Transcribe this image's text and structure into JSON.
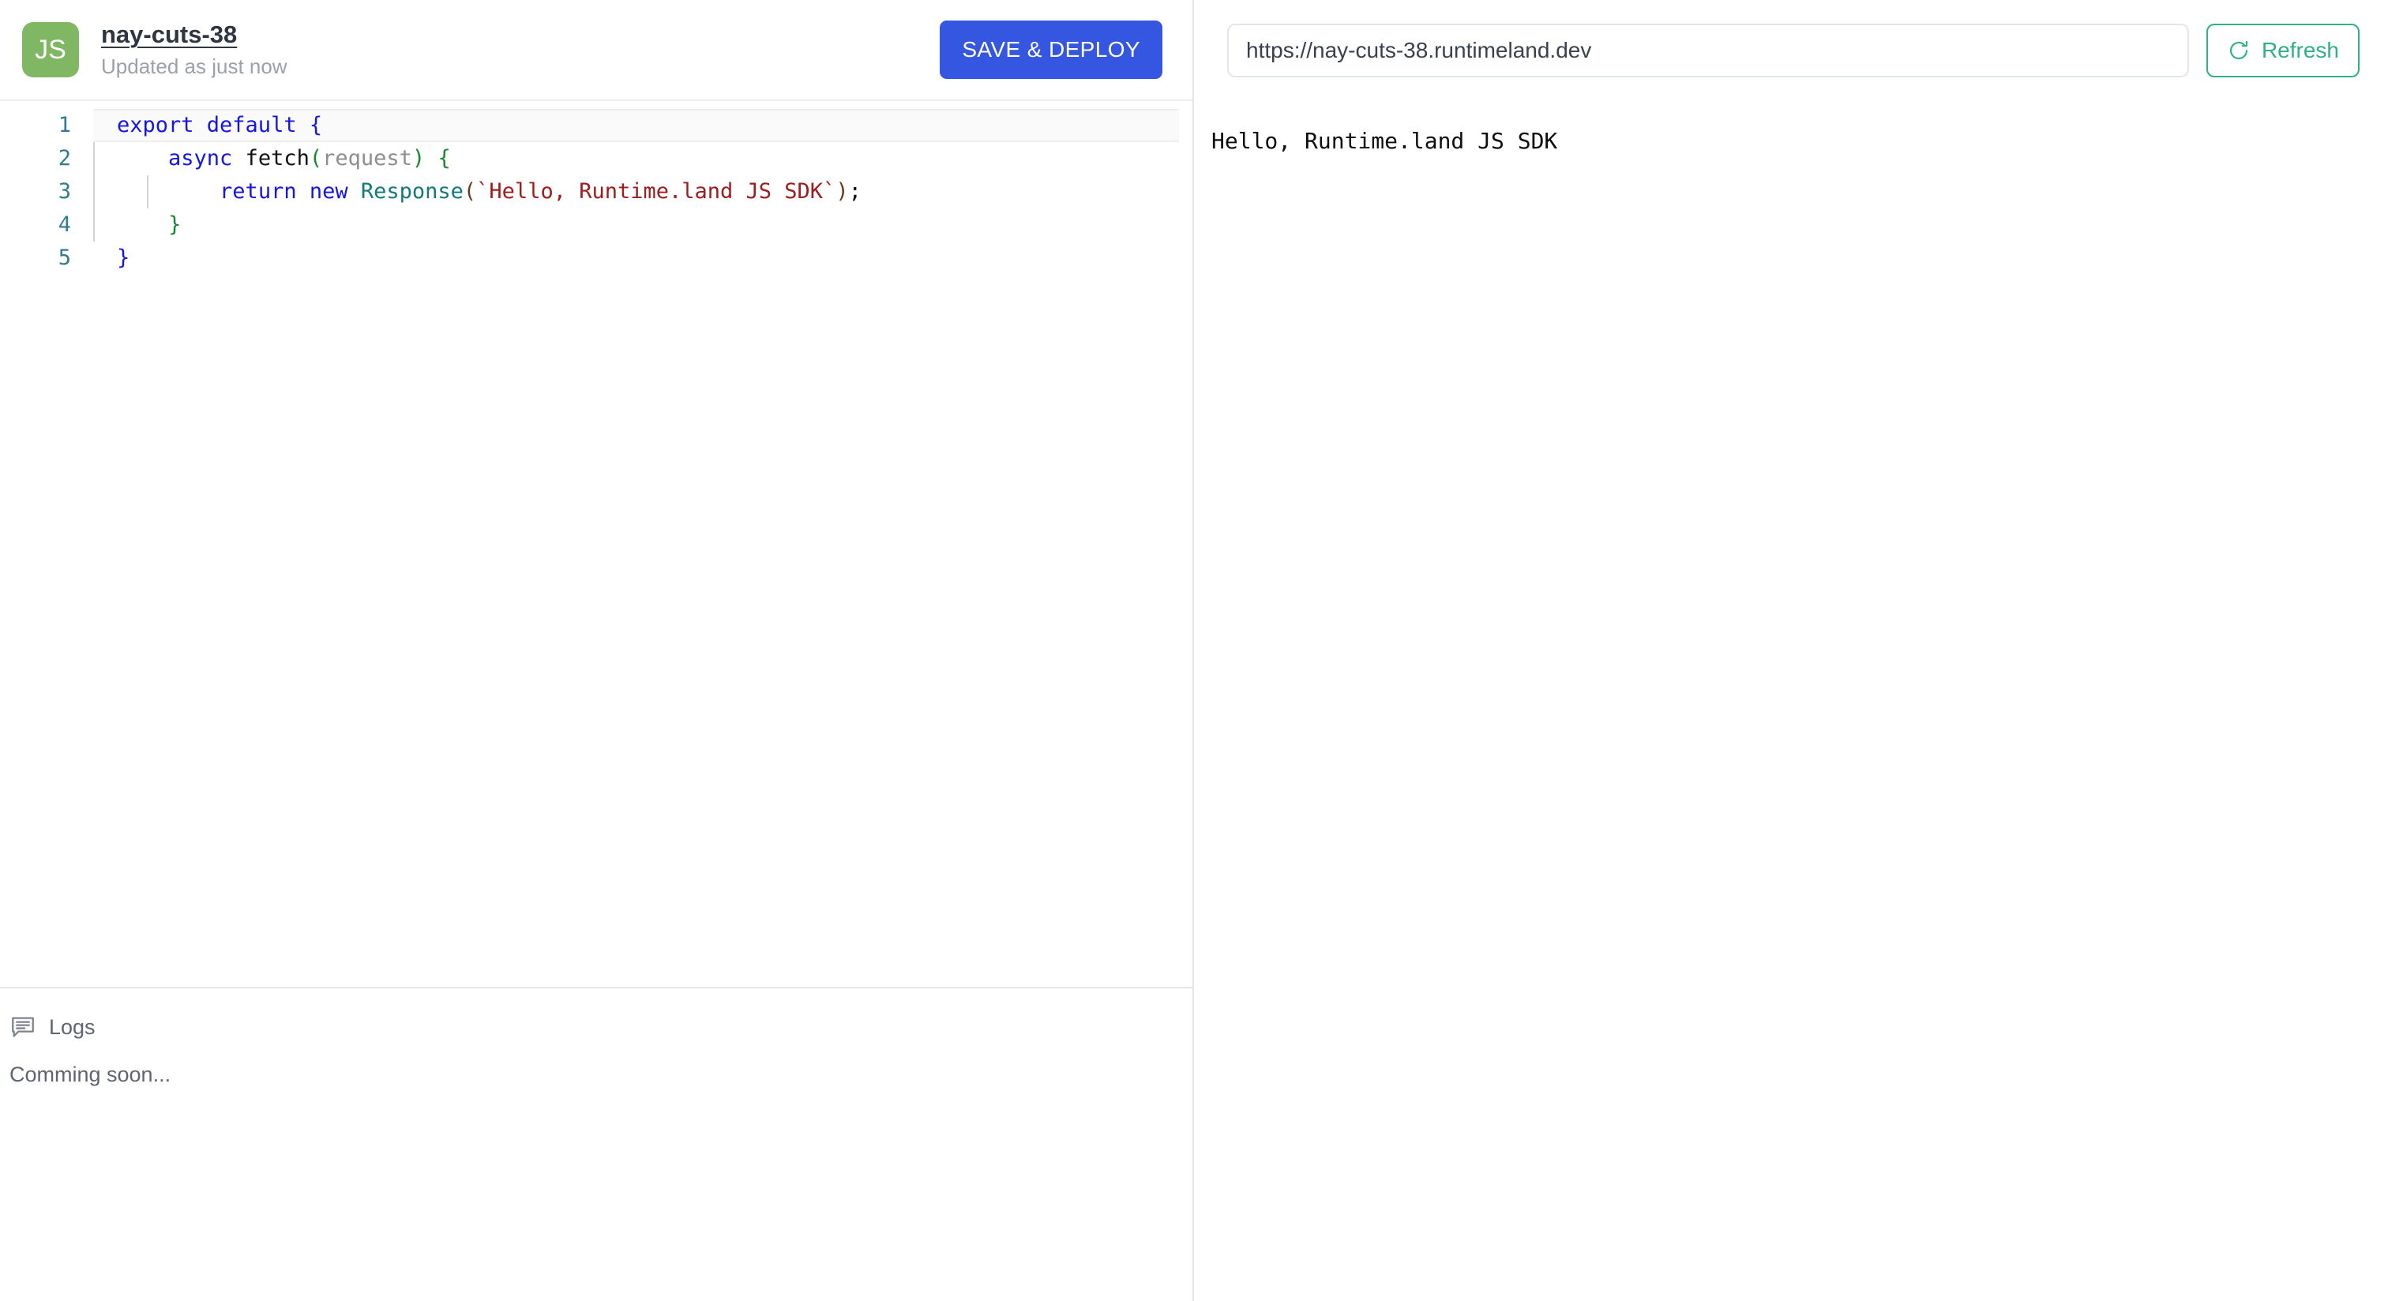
{
  "editor": {
    "badge_label": "JS",
    "project_name": "nay-cuts-38",
    "updated_text": "Updated as just now",
    "save_label": "SAVE & DEPLOY",
    "accent_color": "#3456e0",
    "badge_color": "#7fb763",
    "lines": [
      {
        "number": "1",
        "active": true,
        "guides": 0,
        "tokens": [
          {
            "text": "export default ",
            "cls": "t-kw"
          },
          {
            "text": "{",
            "cls": "t-brace-blue"
          }
        ]
      },
      {
        "number": "2",
        "active": false,
        "guides": 1,
        "tokens": [
          {
            "text": "    ",
            "cls": "t-fn"
          },
          {
            "text": "async",
            "cls": "t-kw"
          },
          {
            "text": " ",
            "cls": "t-fn"
          },
          {
            "text": "fetch",
            "cls": "t-fn"
          },
          {
            "text": "(",
            "cls": "t-par"
          },
          {
            "text": "request",
            "cls": "t-var"
          },
          {
            "text": ")",
            "cls": "t-par"
          },
          {
            "text": " ",
            "cls": "t-fn"
          },
          {
            "text": "{",
            "cls": "t-brace"
          }
        ]
      },
      {
        "number": "3",
        "active": false,
        "guides": 2,
        "tokens": [
          {
            "text": "        ",
            "cls": "t-fn"
          },
          {
            "text": "return new ",
            "cls": "t-kw"
          },
          {
            "text": "Response",
            "cls": "t-cls"
          },
          {
            "text": "(",
            "cls": "t-punc"
          },
          {
            "text": "`Hello, Runtime.land JS SDK`",
            "cls": "t-str"
          },
          {
            "text": ")",
            "cls": "t-punc"
          },
          {
            "text": ";",
            "cls": "t-semi"
          }
        ]
      },
      {
        "number": "4",
        "active": false,
        "guides": 1,
        "tokens": [
          {
            "text": "    ",
            "cls": "t-fn"
          },
          {
            "text": "}",
            "cls": "t-brace"
          }
        ]
      },
      {
        "number": "5",
        "active": false,
        "guides": 0,
        "tokens": [
          {
            "text": "}",
            "cls": "t-brace-blue"
          }
        ]
      }
    ]
  },
  "logs": {
    "icon": "comment-lines-icon",
    "title": "Logs",
    "body": "Comming soon..."
  },
  "preview": {
    "url_value": "https://nay-cuts-38.runtimeland.dev",
    "url_placeholder": "https://",
    "refresh_label": "Refresh",
    "refresh_color": "#2fb183",
    "output": "Hello, Runtime.land JS SDK"
  }
}
